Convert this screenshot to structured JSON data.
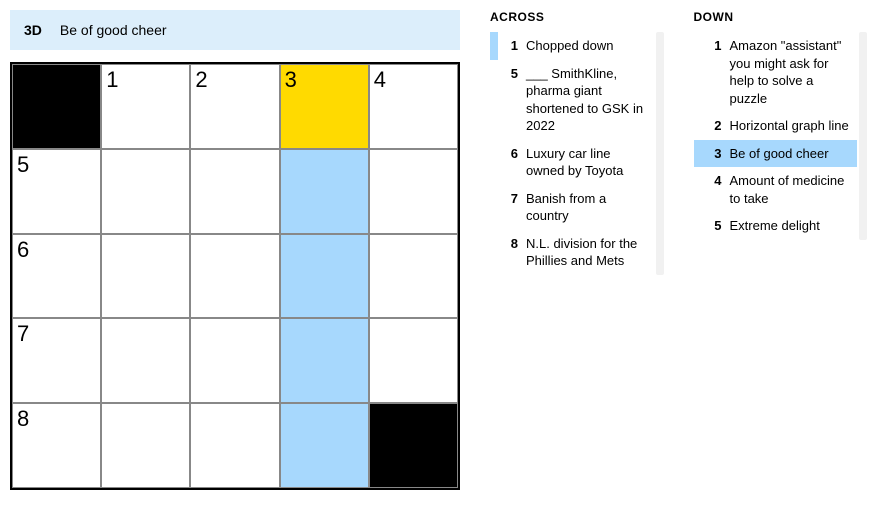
{
  "current_clue": {
    "label": "3D",
    "text": "Be of good cheer"
  },
  "grid": {
    "rows": 5,
    "cols": 5,
    "cells": [
      [
        {
          "black": true
        },
        {
          "num": "1"
        },
        {
          "num": "2"
        },
        {
          "num": "3",
          "cursor": true
        },
        {
          "num": "4"
        }
      ],
      [
        {
          "num": "5"
        },
        {},
        {},
        {
          "hl": true
        },
        {}
      ],
      [
        {
          "num": "6"
        },
        {},
        {},
        {
          "hl": true
        },
        {}
      ],
      [
        {
          "num": "7"
        },
        {},
        {},
        {
          "hl": true
        },
        {}
      ],
      [
        {
          "num": "8"
        },
        {},
        {},
        {
          "hl": true
        },
        {
          "black": true
        }
      ]
    ]
  },
  "across": {
    "heading": "ACROSS",
    "clues": [
      {
        "num": "1",
        "text": "Chopped down",
        "rel": true
      },
      {
        "num": "5",
        "text": "___ SmithKline, pharma giant shortened to GSK in 2022"
      },
      {
        "num": "6",
        "text": "Luxury car line owned by Toyota"
      },
      {
        "num": "7",
        "text": "Banish from a country"
      },
      {
        "num": "8",
        "text": "N.L. division for the Phillies and Mets"
      }
    ]
  },
  "down": {
    "heading": "DOWN",
    "clues": [
      {
        "num": "1",
        "text": "Amazon \"assistant\" you might ask for help to solve a puzzle"
      },
      {
        "num": "2",
        "text": "Horizontal graph line"
      },
      {
        "num": "3",
        "text": "Be of good cheer",
        "active": true
      },
      {
        "num": "4",
        "text": "Amount of medicine to take"
      },
      {
        "num": "5",
        "text": "Extreme delight"
      }
    ]
  }
}
